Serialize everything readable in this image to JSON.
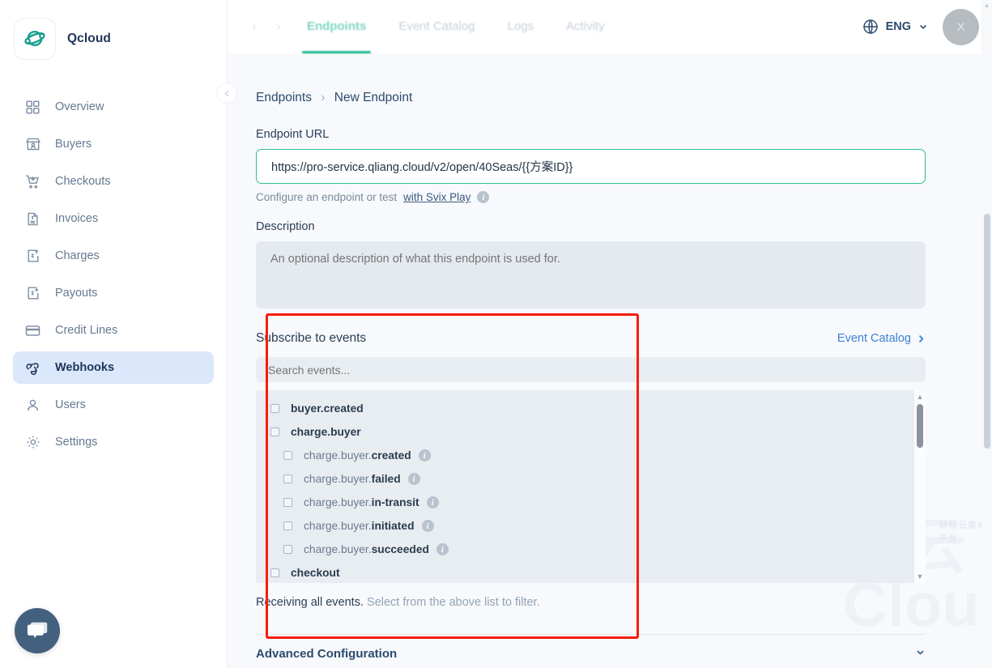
{
  "brand": {
    "name": "Qcloud",
    "logo_icon": "qcloud-planet-logo"
  },
  "sidebar": {
    "collapse_icon": "chevron-left-icon",
    "items": [
      {
        "label": "Overview",
        "icon": "grid-icon",
        "active": false
      },
      {
        "label": "Buyers",
        "icon": "store-icon",
        "active": false
      },
      {
        "label": "Checkouts",
        "icon": "cart-icon",
        "active": false
      },
      {
        "label": "Invoices",
        "icon": "invoice-icon",
        "active": false
      },
      {
        "label": "Charges",
        "icon": "charge-up-icon",
        "active": false
      },
      {
        "label": "Payouts",
        "icon": "payout-down-icon",
        "active": false
      },
      {
        "label": "Credit Lines",
        "icon": "credit-card-icon",
        "active": false
      },
      {
        "label": "Webhooks",
        "icon": "webhook-icon",
        "active": true
      },
      {
        "label": "Users",
        "icon": "user-icon",
        "active": false
      },
      {
        "label": "Settings",
        "icon": "gear-icon",
        "active": false
      }
    ],
    "chat_icon": "chat-bubble-icon"
  },
  "topbar": {
    "nav_back_icon": "chevron-left-icon",
    "nav_forward_icon": "chevron-right-icon",
    "tabs": [
      {
        "label": "Endpoints",
        "active": true
      },
      {
        "label": "Event Catalog",
        "active": false
      },
      {
        "label": "Logs",
        "active": false
      },
      {
        "label": "Activity",
        "active": false
      }
    ],
    "language": {
      "icon": "globe-icon",
      "label": "ENG",
      "chevron": "chevron-down-icon"
    },
    "avatar": {
      "initial": "X"
    }
  },
  "breadcrumb": {
    "root": "Endpoints",
    "separator": "›",
    "current": "New Endpoint"
  },
  "form": {
    "url": {
      "label": "Endpoint URL",
      "value": "https://pro-service.qliang.cloud/v2/open/40Seas/{{方案ID}}",
      "hint_prefix": "Configure an endpoint or test",
      "hint_link": "with Svix Play",
      "hint_info_icon": "info-icon"
    },
    "description": {
      "label": "Description",
      "value": "",
      "placeholder": "An optional description of what this endpoint is used for."
    }
  },
  "events": {
    "title": "Subscribe to events",
    "catalog_link": "Event Catalog",
    "catalog_chevron_icon": "chevron-right-icon",
    "search_placeholder": "Search events...",
    "search_value": "",
    "list": [
      {
        "prefix": "",
        "suffix": "buyer.created",
        "full": "buyer.created",
        "level": 0,
        "checked": false,
        "info": false
      },
      {
        "prefix": "",
        "suffix": "charge.buyer",
        "full": "charge.buyer",
        "level": 0,
        "checked": false,
        "info": false
      },
      {
        "prefix": "charge.buyer.",
        "suffix": "created",
        "full": "charge.buyer.created",
        "level": 1,
        "checked": false,
        "info": true
      },
      {
        "prefix": "charge.buyer.",
        "suffix": "failed",
        "full": "charge.buyer.failed",
        "level": 1,
        "checked": false,
        "info": true
      },
      {
        "prefix": "charge.buyer.",
        "suffix": "in-transit",
        "full": "charge.buyer.in-transit",
        "level": 1,
        "checked": false,
        "info": true
      },
      {
        "prefix": "charge.buyer.",
        "suffix": "initiated",
        "full": "charge.buyer.initiated",
        "level": 1,
        "checked": false,
        "info": true
      },
      {
        "prefix": "charge.buyer.",
        "suffix": "succeeded",
        "full": "charge.buyer.succeeded",
        "level": 1,
        "checked": false,
        "info": true
      },
      {
        "prefix": "",
        "suffix": "checkout",
        "full": "checkout",
        "level": 0,
        "checked": false,
        "info": false
      }
    ],
    "scroll_up_icon": "triangle-up-icon",
    "scroll_down_icon": "triangle-down-icon",
    "status_main": "Receiving all events.",
    "status_muted": "Select from the above list to filter."
  },
  "advanced": {
    "label": "Advanced Configuration",
    "chevron_icon": "chevron-down-icon"
  },
  "watermark": {
    "big": "易云",
    "sub": "Cloud",
    "small": "财易云集成平台"
  },
  "annotation": {
    "color": "#f71d0b"
  },
  "colors": {
    "accent_teal": "#21b892",
    "brand_navy": "#1d3557",
    "active_nav_bg": "#dbe7fb",
    "link_blue": "#3b82d6",
    "input_border_green": "#2fbf8f"
  }
}
